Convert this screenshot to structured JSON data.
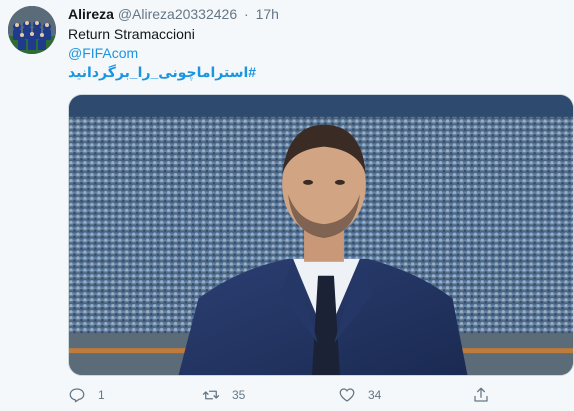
{
  "tweet": {
    "display_name": "Alireza",
    "handle": "@Alireza20332426",
    "separator": "·",
    "time": "17h",
    "text_line1": "Return Stramaccioni",
    "mention": "@FIFAcom",
    "hashtag": "#استراماچونی_را_برگردانید"
  },
  "actions": {
    "reply_count": "1",
    "retweet_count": "35",
    "like_count": "34"
  },
  "icons": [
    "reply-icon",
    "retweet-icon",
    "like-icon",
    "share-icon"
  ],
  "colors": {
    "link": "#1b95e0",
    "muted": "#657786",
    "background": "#f5f8fa"
  }
}
